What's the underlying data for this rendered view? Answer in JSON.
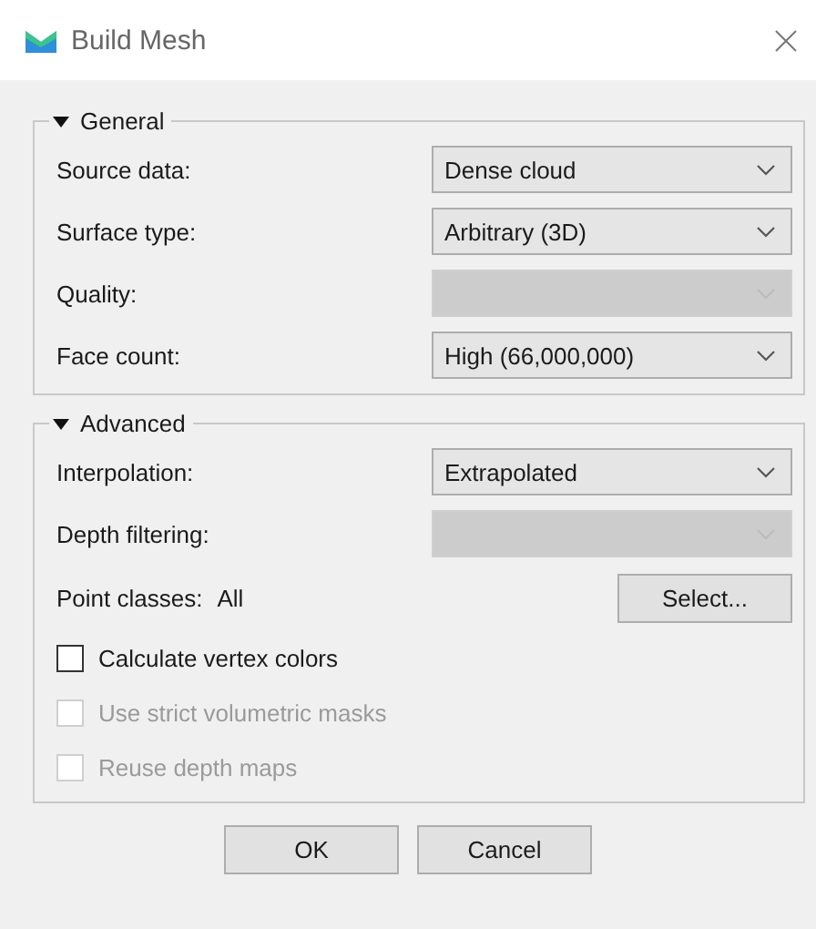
{
  "window": {
    "title": "Build Mesh"
  },
  "groups": [
    {
      "title": "General",
      "expanded": true,
      "rows": [
        {
          "kind": "combo",
          "label": "Source data:",
          "value": "Dense cloud",
          "disabled": false
        },
        {
          "kind": "combo",
          "label": "Surface type:",
          "value": "Arbitrary (3D)",
          "disabled": false
        },
        {
          "kind": "combo",
          "label": "Quality:",
          "disabled": true
        },
        {
          "kind": "combo",
          "label": "Face count:",
          "value": "High (66,000,000)",
          "disabled": false
        }
      ]
    },
    {
      "title": "Advanced",
      "expanded": true,
      "rows": [
        {
          "kind": "combo",
          "label": "Interpolation:",
          "value": "Extrapolated",
          "disabled": false
        },
        {
          "kind": "combo",
          "label": "Depth filtering:",
          "disabled": true
        },
        {
          "kind": "picker",
          "label": "Point classes:",
          "value": "All",
          "button": "Select..."
        },
        {
          "kind": "checkbox",
          "label": "Calculate vertex colors",
          "checked": false,
          "disabled": false
        },
        {
          "kind": "checkbox",
          "label": "Use strict volumetric masks",
          "checked": false,
          "disabled": true
        },
        {
          "kind": "checkbox",
          "label": "Reuse depth maps",
          "checked": false,
          "disabled": true
        }
      ]
    }
  ],
  "buttons": [
    "OK",
    "Cancel"
  ]
}
